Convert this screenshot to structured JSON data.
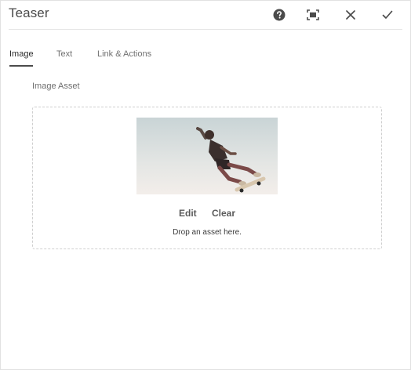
{
  "dialog": {
    "title": "Teaser"
  },
  "header_actions": [
    {
      "name": "help",
      "icon": "help-icon"
    },
    {
      "name": "fullscreen",
      "icon": "fullscreen-icon"
    },
    {
      "name": "cancel",
      "icon": "close-icon"
    },
    {
      "name": "done",
      "icon": "checkmark-icon"
    }
  ],
  "tabs": [
    {
      "label": "Image",
      "active": true
    },
    {
      "label": "Text",
      "active": false
    },
    {
      "label": "Link & Actions",
      "active": false
    }
  ],
  "image_field": {
    "label": "Image Asset",
    "thumbnail": "skateboarder-photo",
    "edit_label": "Edit",
    "clear_label": "Clear",
    "drop_hint": "Drop an asset here."
  },
  "colors": {
    "text": "#4b4b4b",
    "divider": "#e6e6e6",
    "dropzone_border": "#cfcfcf"
  }
}
